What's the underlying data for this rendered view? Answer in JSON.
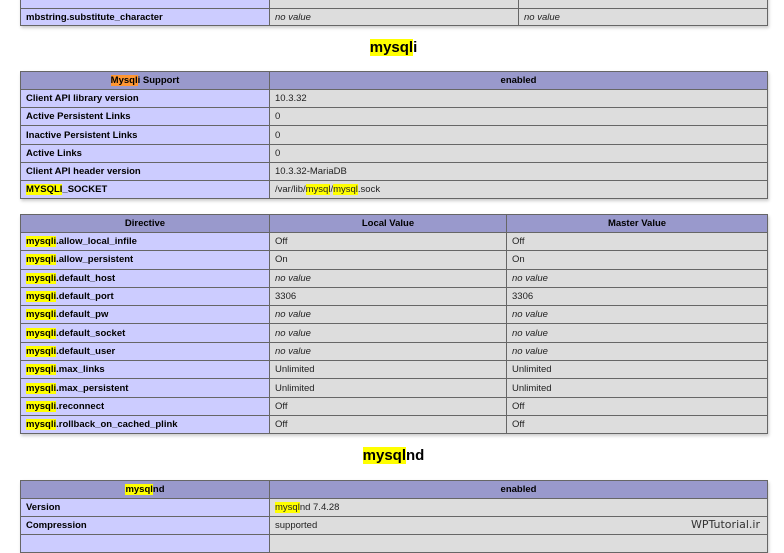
{
  "mbstring": {
    "substitute_key": "mbstring.substitute_character",
    "substitute_local": "no value",
    "substitute_master": "no value"
  },
  "mysqli": {
    "title_hl": "mysql",
    "title_rest": "i",
    "support_head_hl": "Mysql",
    "support_head_rest": "i Support",
    "support_value": "enabled",
    "rows": {
      "client_api_key": "Client API library version",
      "client_api_val": "10.3.32",
      "active_pers_key": "Active Persistent Links",
      "active_pers_val": "0",
      "inactive_pers_key": "Inactive Persistent Links",
      "inactive_pers_val": "0",
      "active_links_key": "Active Links",
      "active_links_val": "0",
      "header_ver_key": "Client API header version",
      "header_ver_val": "10.3.32-MariaDB",
      "socket_key_hl": "MYSQLI",
      "socket_key_rest": "_SOCKET",
      "socket_val_1": "/var/lib/",
      "socket_val_hl1": "mysql",
      "socket_val_2": "/",
      "socket_val_hl2": "mysql",
      "socket_val_3": ".sock"
    },
    "directive_head": "Directive",
    "local_head": "Local Value",
    "master_head": "Master Value",
    "prefix": "mysqli",
    "directives": [
      {
        "name": ".allow_local_infile",
        "local": "Off",
        "master": "Off"
      },
      {
        "name": ".allow_persistent",
        "local": "On",
        "master": "On"
      },
      {
        "name": ".default_host",
        "local": "no value",
        "master": "no value"
      },
      {
        "name": ".default_port",
        "local": "3306",
        "master": "3306"
      },
      {
        "name": ".default_pw",
        "local": "no value",
        "master": "no value"
      },
      {
        "name": ".default_socket",
        "local": "no value",
        "master": "no value"
      },
      {
        "name": ".default_user",
        "local": "no value",
        "master": "no value"
      },
      {
        "name": ".max_links",
        "local": "Unlimited",
        "master": "Unlimited"
      },
      {
        "name": ".max_persistent",
        "local": "Unlimited",
        "master": "Unlimited"
      },
      {
        "name": ".reconnect",
        "local": "Off",
        "master": "Off"
      },
      {
        "name": ".rollback_on_cached_plink",
        "local": "Off",
        "master": "Off"
      }
    ]
  },
  "mysqlnd": {
    "title_hl": "mysql",
    "title_rest": "nd",
    "head_hl": "mysql",
    "head_rest": "nd",
    "head_value": "enabled",
    "version_key": "Version",
    "version_hl": "mysql",
    "version_rest": "nd 7.4.28",
    "compression_key": "Compression",
    "compression_val": "supported"
  },
  "watermark": "WPTutorial.ir",
  "colors": {
    "header": "#9999cc",
    "key_cell": "#ccccff",
    "value_cell": "#dddddd",
    "highlight": "#ffff00",
    "highlight_active": "#ff9632"
  }
}
